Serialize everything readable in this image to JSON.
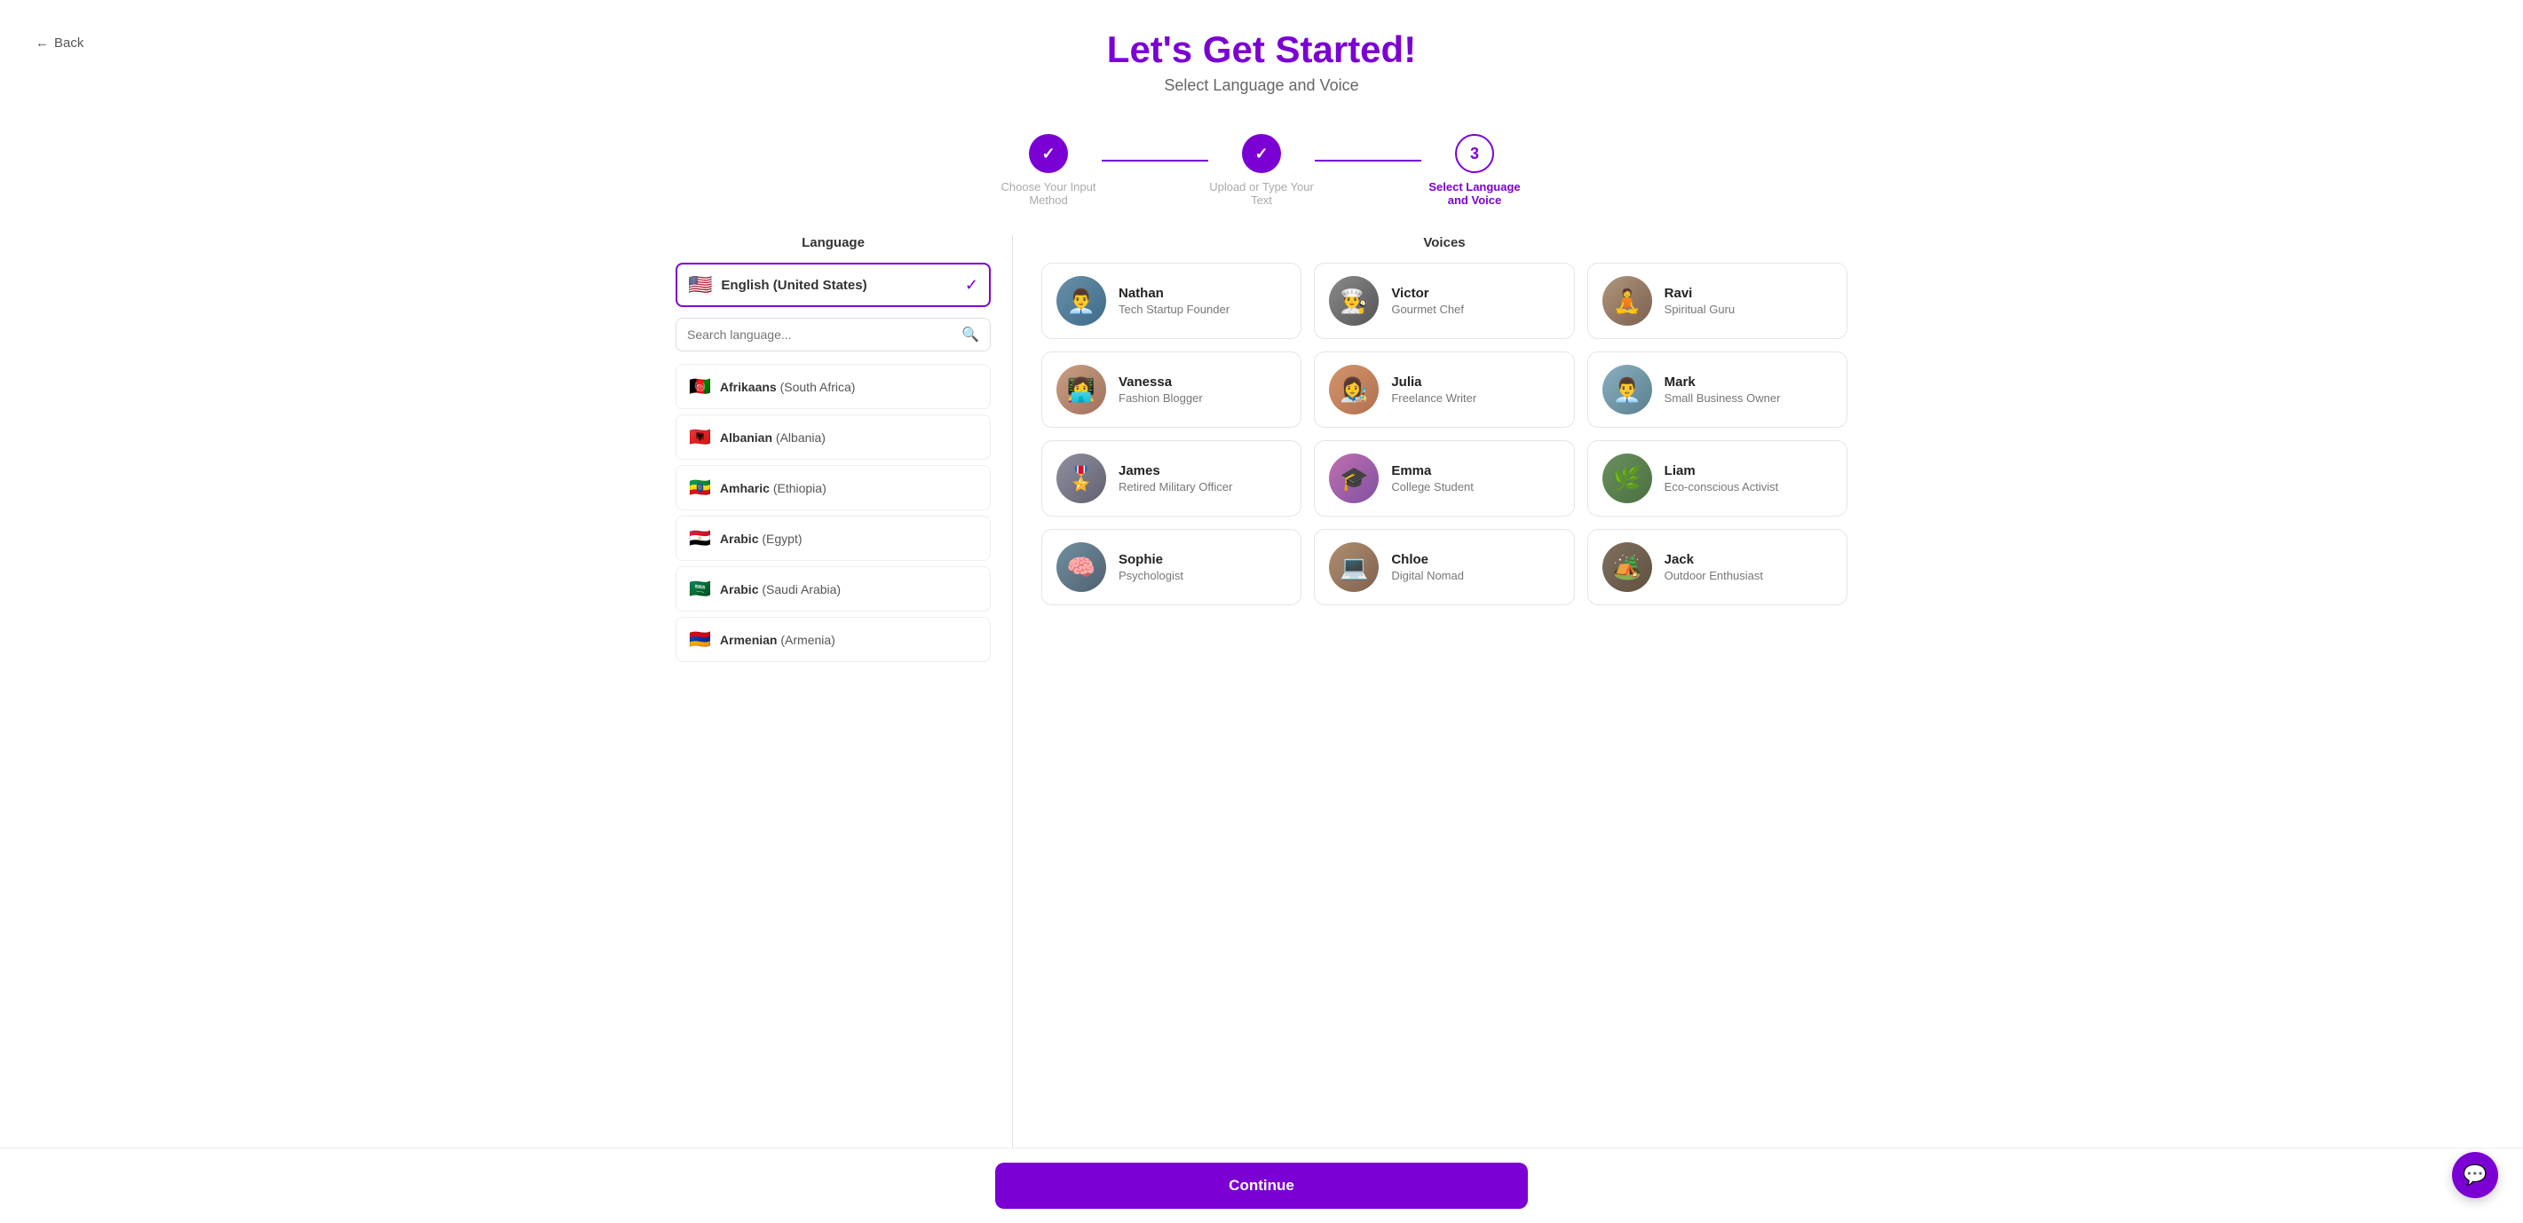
{
  "header": {
    "back_label": "Back",
    "title": "Let's Get Started!",
    "subtitle": "Select Language and Voice"
  },
  "stepper": {
    "steps": [
      {
        "id": "input-method",
        "label": "Choose Your Input Method",
        "state": "done",
        "number": "✓"
      },
      {
        "id": "upload-text",
        "label": "Upload or Type Your Text",
        "state": "done",
        "number": "✓"
      },
      {
        "id": "language-voice",
        "label": "Select Language and Voice",
        "state": "active",
        "number": "3"
      }
    ],
    "lines": [
      "done",
      "active"
    ]
  },
  "language_panel": {
    "title": "Language",
    "selected": {
      "flag": "🇺🇸",
      "name": "English",
      "region": "(United States)"
    },
    "search_placeholder": "Search language...",
    "languages": [
      {
        "flag": "🇦🇫",
        "name": "Afrikaans",
        "region": "(South Africa)"
      },
      {
        "flag": "🇦🇱",
        "name": "Albanian",
        "region": "(Albania)"
      },
      {
        "flag": "🇪🇹",
        "name": "Amharic",
        "region": "(Ethiopia)"
      },
      {
        "flag": "🇪🇬",
        "name": "Arabic",
        "region": "(Egypt)"
      },
      {
        "flag": "🇸🇦",
        "name": "Arabic",
        "region": "(Saudi Arabia)"
      },
      {
        "flag": "🇦🇲",
        "name": "Armenian",
        "region": "(Armenia)"
      }
    ]
  },
  "voices_panel": {
    "title": "Voices",
    "voices": [
      {
        "id": "nathan",
        "name": "Nathan",
        "role": "Tech Startup Founder",
        "avatar_class": "av-nathan",
        "emoji": "👨‍💼"
      },
      {
        "id": "victor",
        "name": "Victor",
        "role": "Gourmet Chef",
        "avatar_class": "av-victor",
        "emoji": "👨‍🍳"
      },
      {
        "id": "ravi",
        "name": "Ravi",
        "role": "Spiritual Guru",
        "avatar_class": "av-ravi",
        "emoji": "🧘"
      },
      {
        "id": "vanessa",
        "name": "Vanessa",
        "role": "Fashion Blogger",
        "avatar_class": "av-vanessa",
        "emoji": "👩‍💻"
      },
      {
        "id": "julia",
        "name": "Julia",
        "role": "Freelance Writer",
        "avatar_class": "av-julia",
        "emoji": "👩‍🎨"
      },
      {
        "id": "mark",
        "name": "Mark",
        "role": "Small Business Owner",
        "avatar_class": "av-mark",
        "emoji": "👨‍💼"
      },
      {
        "id": "james",
        "name": "James",
        "role": "Retired Military Officer",
        "avatar_class": "av-james",
        "emoji": "🎖️"
      },
      {
        "id": "emma",
        "name": "Emma",
        "role": "College Student",
        "avatar_class": "av-emma",
        "emoji": "🎓"
      },
      {
        "id": "liam",
        "name": "Liam",
        "role": "Eco-conscious Activist",
        "avatar_class": "av-liam",
        "emoji": "🌿"
      },
      {
        "id": "sophie",
        "name": "Sophie",
        "role": "Psychologist",
        "avatar_class": "av-sophie",
        "emoji": "🧠"
      },
      {
        "id": "chloe",
        "name": "Chloe",
        "role": "Digital Nomad",
        "avatar_class": "av-chloe",
        "emoji": "💻"
      },
      {
        "id": "jack",
        "name": "Jack",
        "role": "Outdoor Enthusiast",
        "avatar_class": "av-jack",
        "emoji": "🏕️"
      }
    ]
  },
  "footer": {
    "continue_label": "Continue"
  },
  "icons": {
    "back_arrow": "←",
    "check": "✓",
    "search": "🔍",
    "chat": "💬"
  }
}
